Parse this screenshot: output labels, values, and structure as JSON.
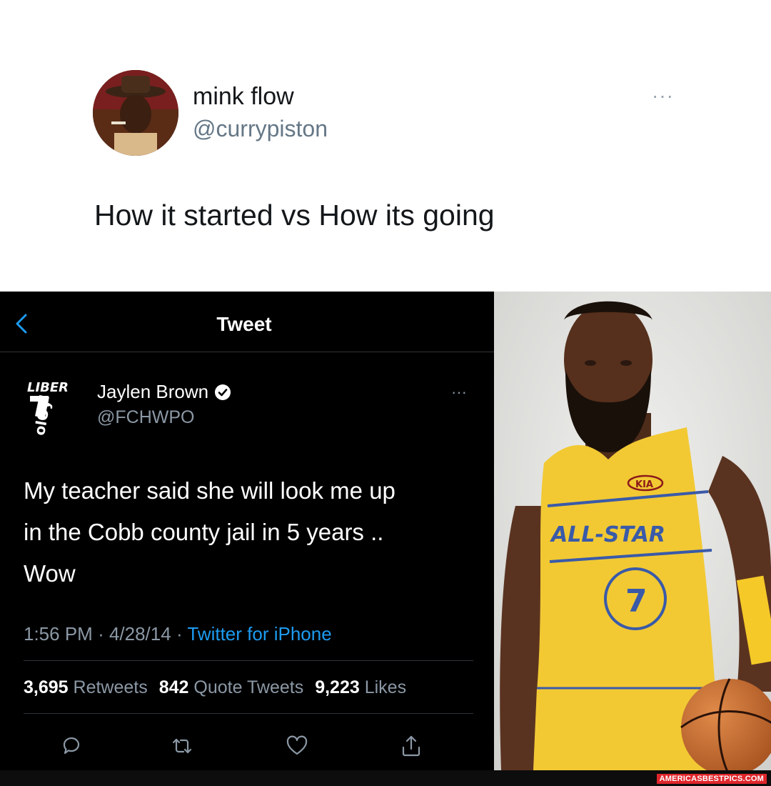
{
  "outer_tweet": {
    "author_name": "mink flow",
    "author_handle": "@currypiston",
    "more_label": "···",
    "text": "How it started vs How its going"
  },
  "embedded_tweet": {
    "header_title": "Tweet",
    "author_name": "Jaylen Brown",
    "author_handle": "@FCHWPO",
    "more_label": "···",
    "text_lines": [
      "My teacher said she will look me up",
      "in the Cobb county jail in 5 years ..",
      "Wow"
    ],
    "time": "1:56 PM",
    "date": "4/28/14",
    "source": "Twitter for iPhone",
    "stats": {
      "retweets_count": "3,695",
      "retweets_label": "Retweets",
      "quotes_count": "842",
      "quotes_label": "Quote Tweets",
      "likes_count": "9,223",
      "likes_label": "Likes"
    },
    "actions": [
      "reply-icon",
      "retweet-icon",
      "like-icon",
      "share-icon"
    ]
  },
  "photo": {
    "jersey_sponsor": "KIA",
    "jersey_text": "ALL-STAR",
    "jersey_number": "7"
  },
  "watermark": "AMERICASBESTPICS.COM",
  "colors": {
    "link_blue": "#1d9bf0",
    "jersey_yellow": "#f2c933",
    "dark_bg": "#000000"
  }
}
